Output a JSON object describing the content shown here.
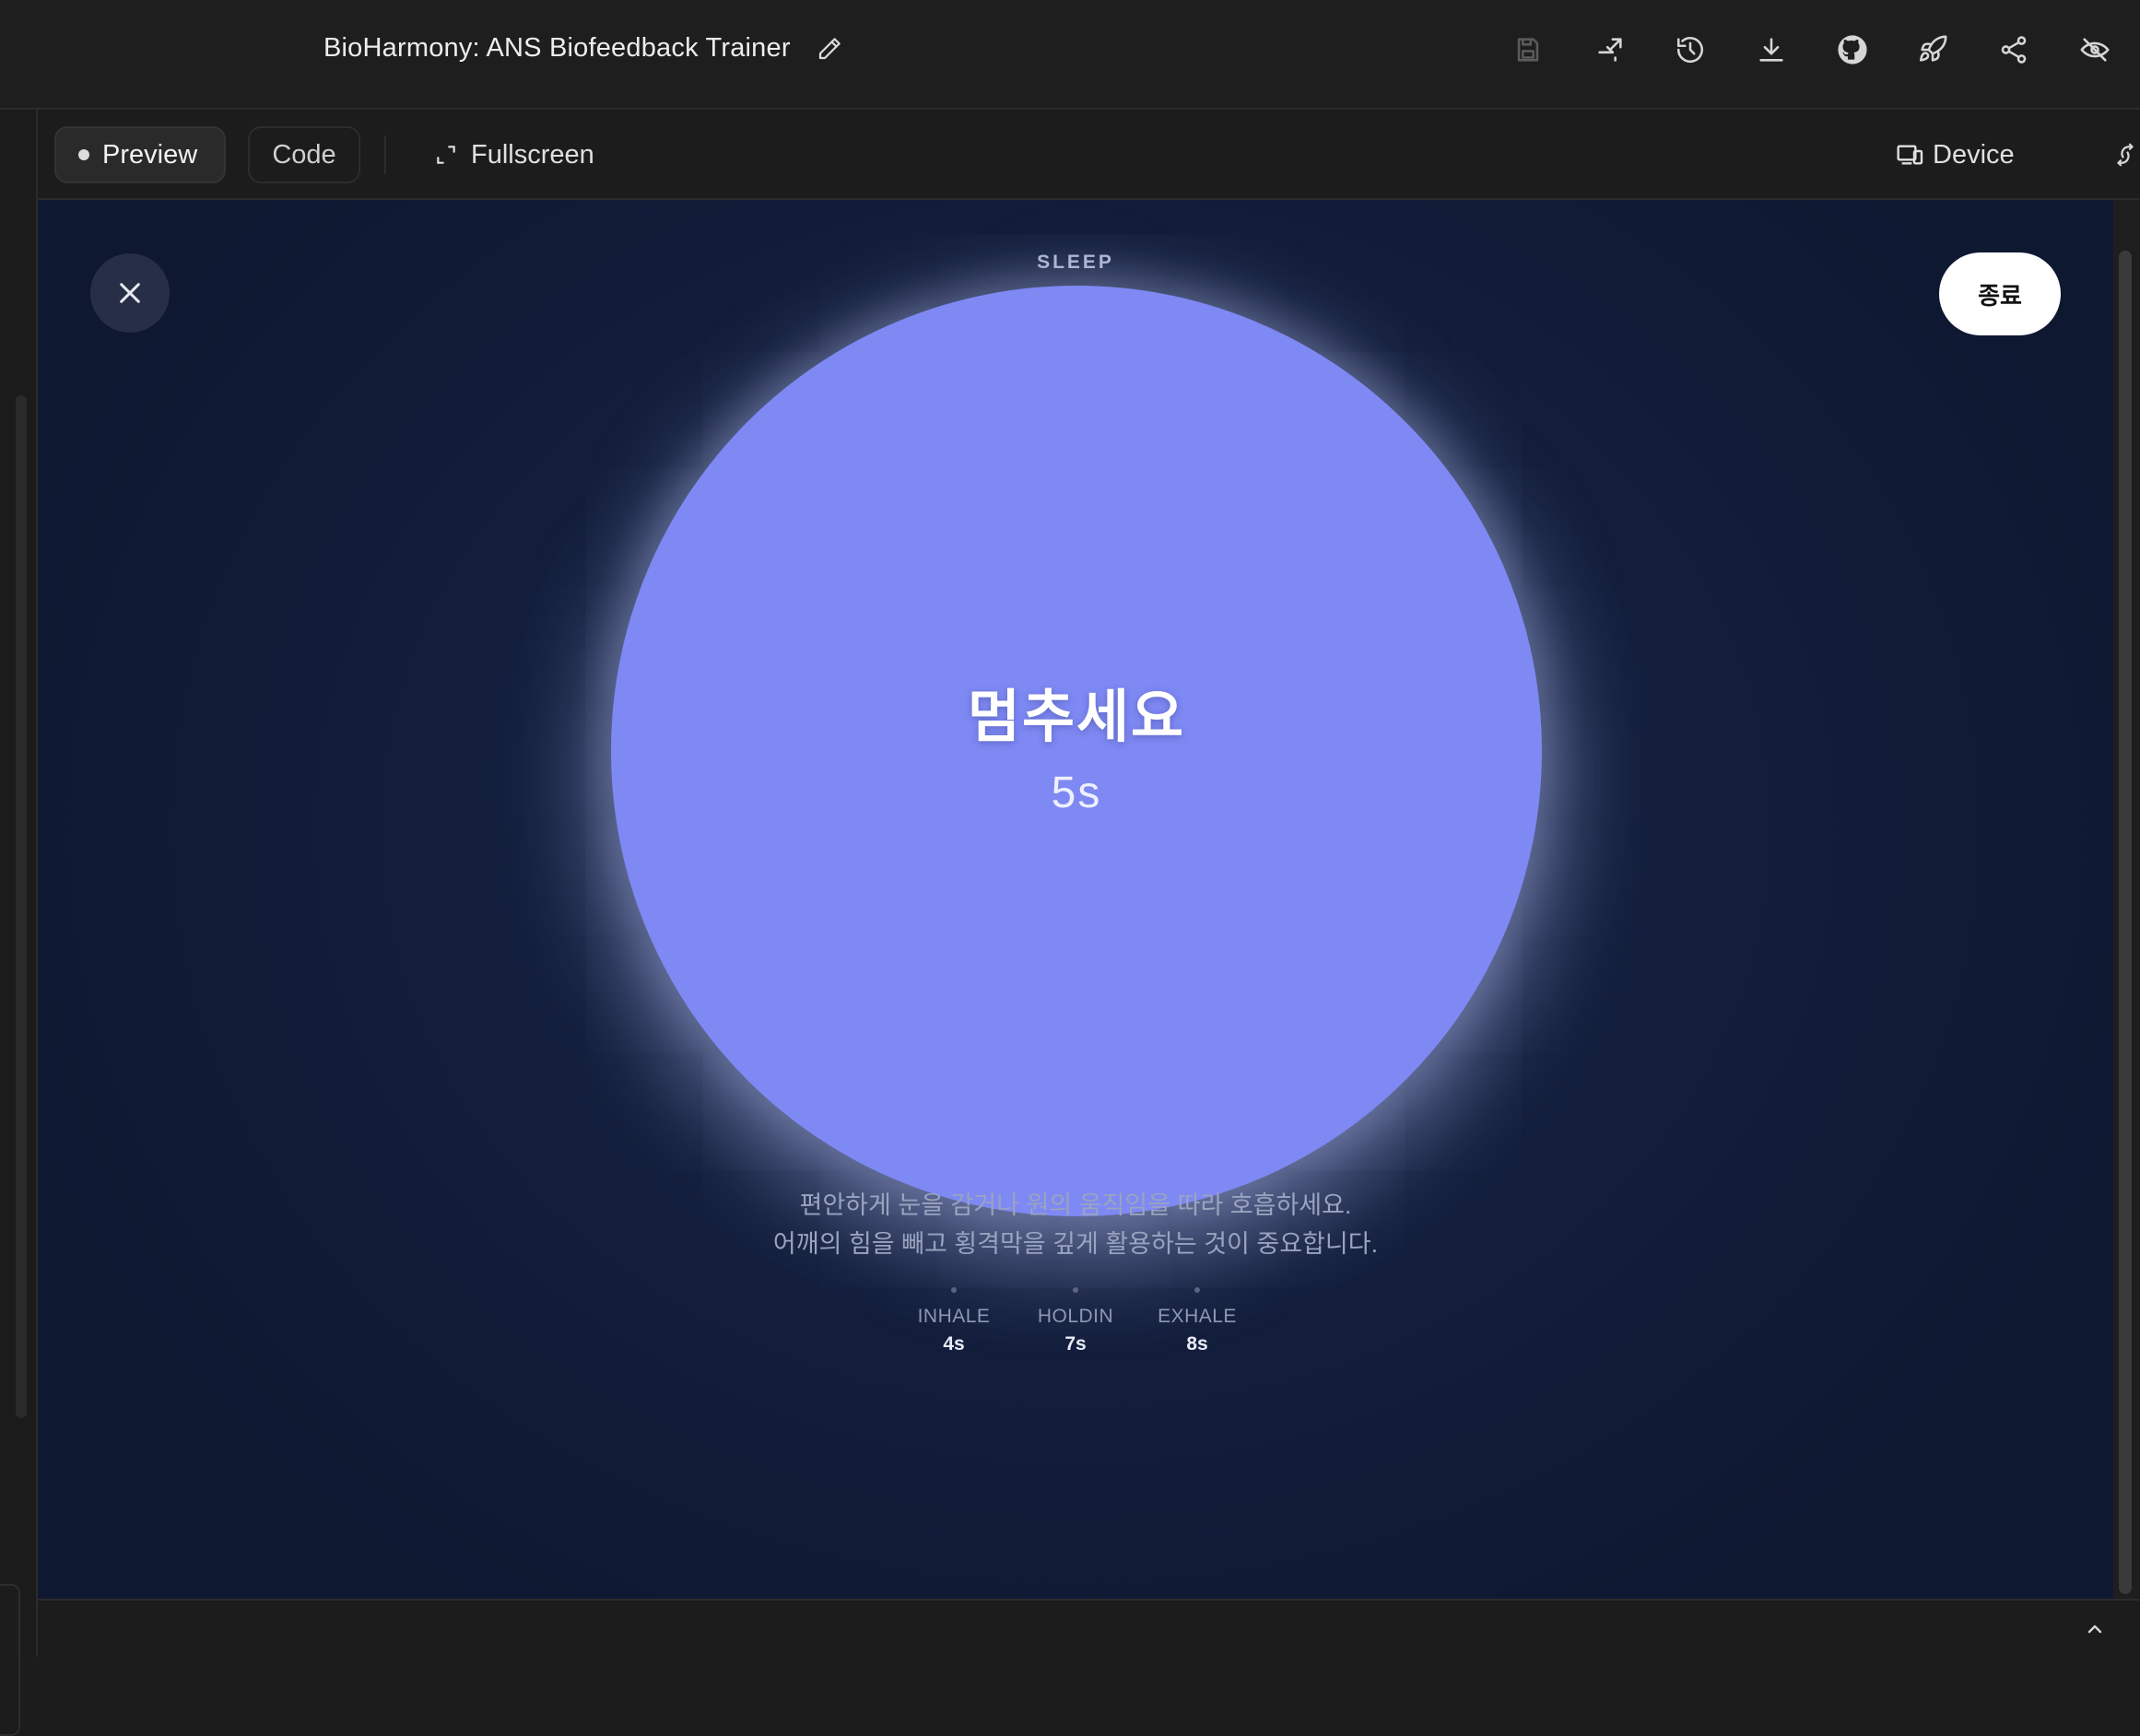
{
  "app": {
    "project_title": "BioHarmony: ANS Biofeedback Trainer"
  },
  "topbar": {
    "icons": [
      "save-icon",
      "fork-icon",
      "history-icon",
      "download-icon",
      "github-icon",
      "deploy-rocket-icon",
      "share-icon",
      "hide-eye-icon"
    ]
  },
  "toolbar": {
    "preview_label": "Preview",
    "code_label": "Code",
    "fullscreen_label": "Fullscreen",
    "device_label": "Device"
  },
  "session": {
    "mode": "SLEEP",
    "end_label": "종료",
    "phase_text": "멈추세요",
    "countdown": "5s",
    "instruction_line1": "편안하게 눈을 감거나 원의 움직임을 따라 호흡하세요.",
    "instruction_line2": "어깨의 힘을 빼고 횡격막을 깊게 활용하는 것이 중요합니다.",
    "phases": [
      {
        "name": "INHALE",
        "value": "4s"
      },
      {
        "name": "HOLDIN",
        "value": "7s"
      },
      {
        "name": "EXHALE",
        "value": "8s"
      }
    ]
  },
  "colors": {
    "orb": "#7e89f4",
    "background": "#14203f",
    "end_button": "#ffffff"
  }
}
